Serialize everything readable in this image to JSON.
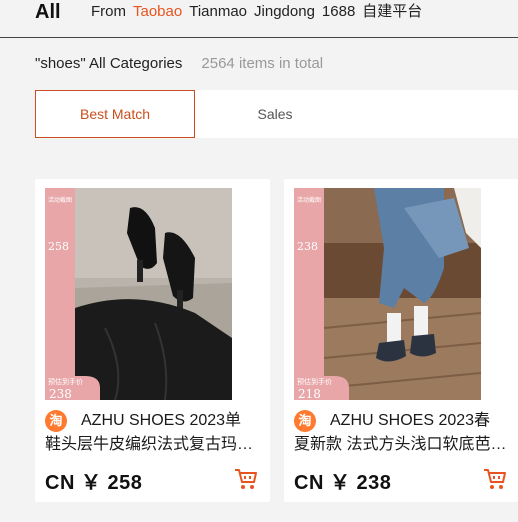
{
  "filter": {
    "title": "All",
    "from_label": "From",
    "sources": [
      "Taobao",
      "Tianmao",
      "Jingdong",
      "1688",
      "自建平台"
    ],
    "active_source": "Taobao"
  },
  "summary": {
    "query_text": "\"shoes\" All Categories",
    "count_text": "2564 items in total"
  },
  "sort": {
    "tabs": [
      "Best Match",
      "Sales"
    ],
    "active": "Best Match"
  },
  "products": [
    {
      "badge": "淘",
      "title_line1": "AZHU SHOES 2023单",
      "title_line2": "鞋头层牛皮编织法式复古玛…",
      "price": "CN ￥ 258",
      "overlay": {
        "top": "活动截图",
        "mid": "258",
        "bottom_label": "预估到手价",
        "bottom_price": "238"
      }
    },
    {
      "badge": "淘",
      "title_line1": "AZHU SHOES 2023春",
      "title_line2": "夏新款 法式方头浅口软底芭…",
      "price": "CN ￥ 238",
      "overlay": {
        "top": "活动截图",
        "mid": "238",
        "bottom_label": "预估到手价",
        "bottom_price": "218"
      }
    }
  ],
  "colors": {
    "accent": "#e8541f",
    "tab_border": "#c9501e",
    "badge": "#ff7a2e",
    "overlay_pink": "#e8a6a8"
  }
}
